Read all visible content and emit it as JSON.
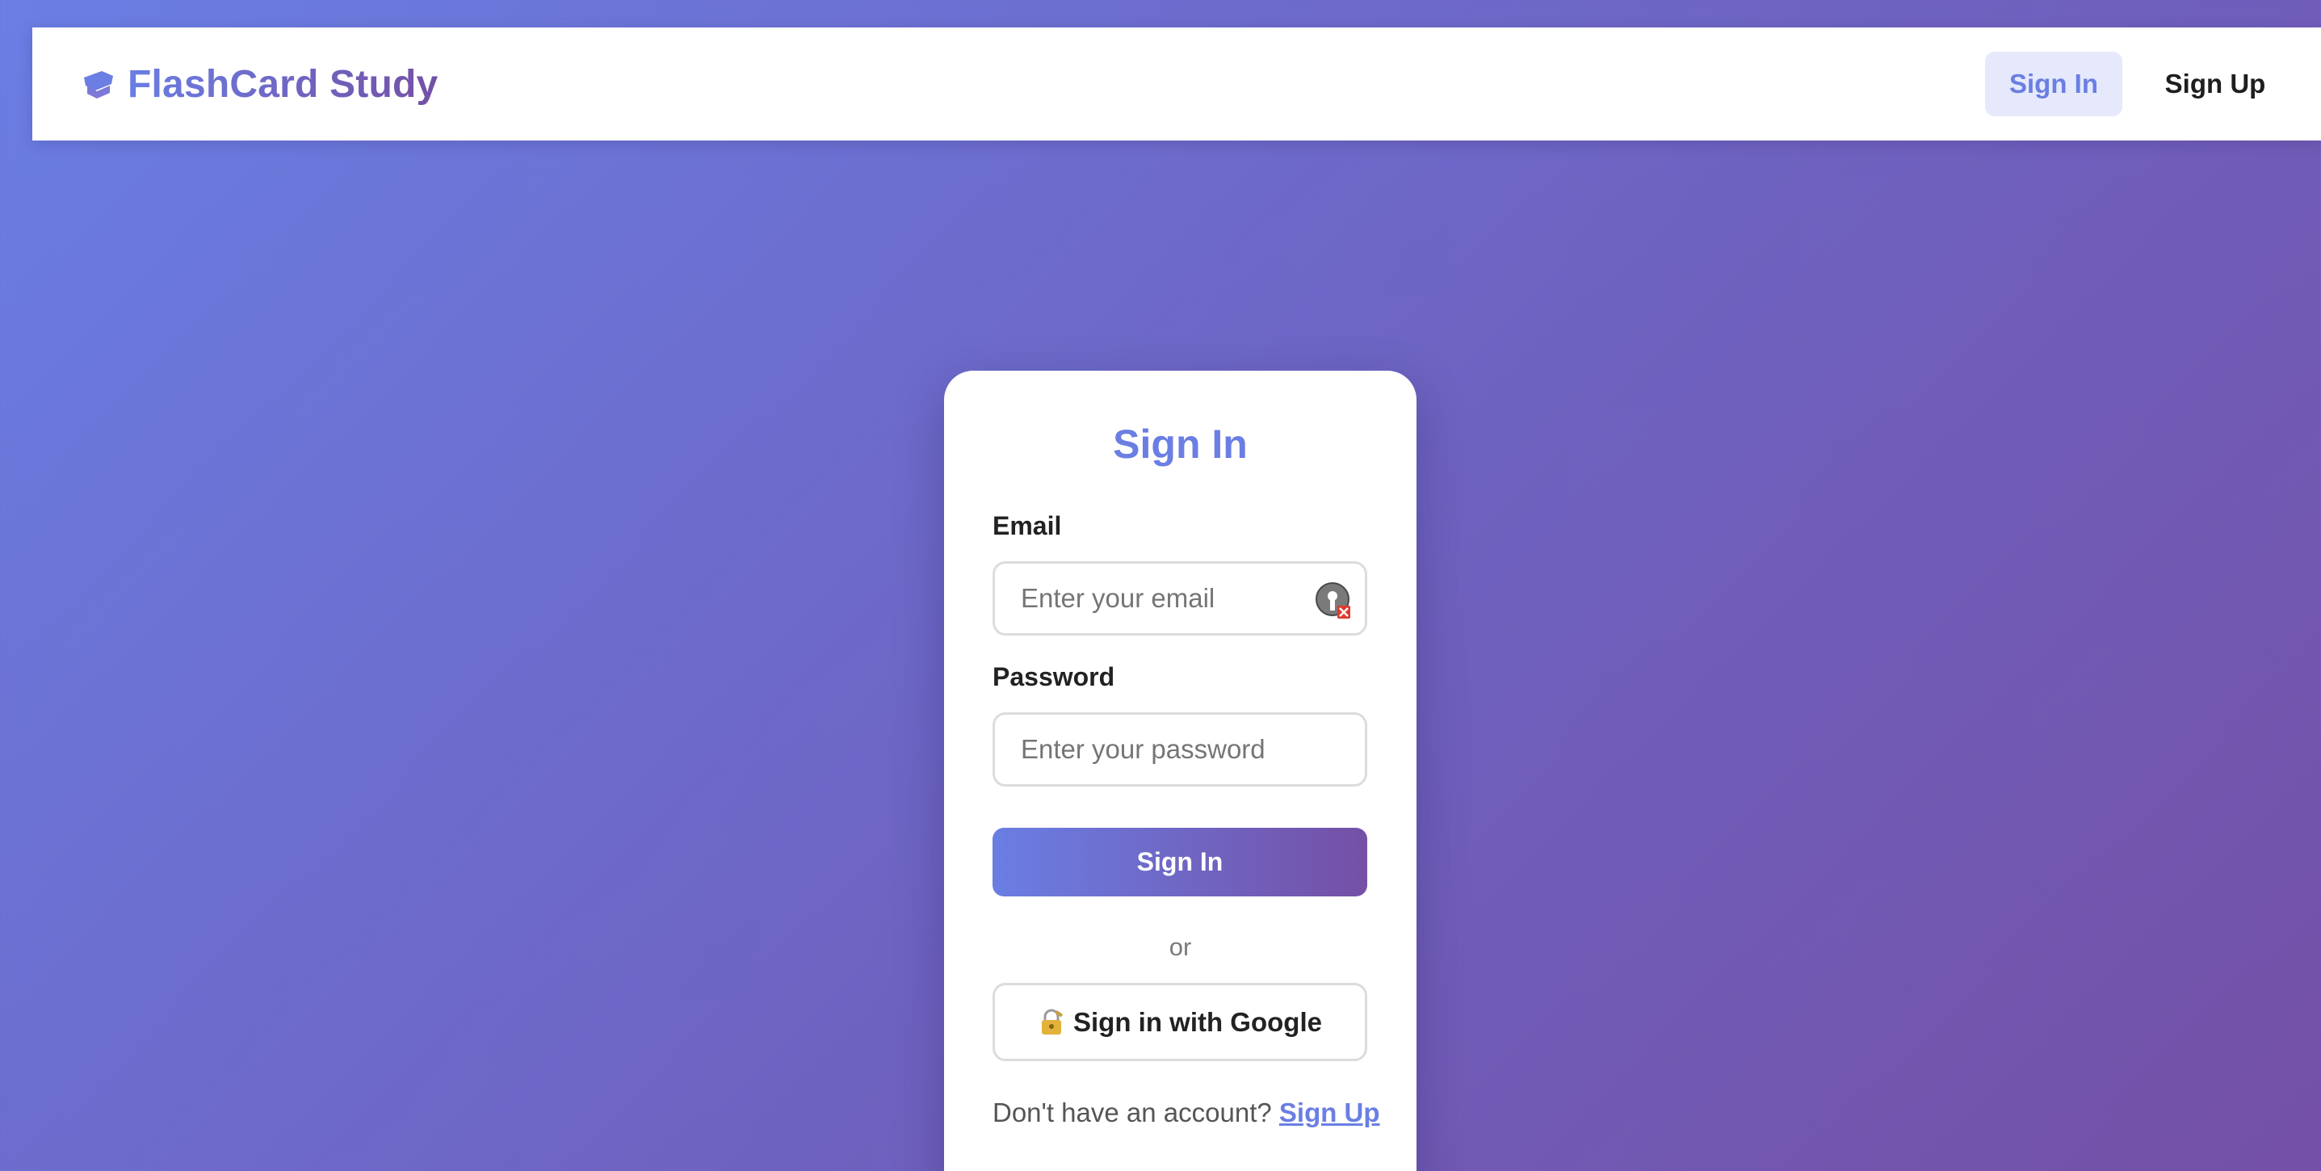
{
  "header": {
    "brand_title": "FlashCard Study",
    "brand_icon": "graduation-cap-icon",
    "nav": {
      "signin_label": "Sign In",
      "signup_label": "Sign Up"
    }
  },
  "signin_card": {
    "title": "Sign In",
    "email": {
      "label": "Email",
      "placeholder": "Enter your email",
      "value": "",
      "icon": "password-manager-icon"
    },
    "password": {
      "label": "Password",
      "placeholder": "Enter your password",
      "value": ""
    },
    "submit_label": "Sign In",
    "divider": "or",
    "google": {
      "icon": "lock-key-icon",
      "label": "Sign in with Google"
    },
    "footer": {
      "prompt": "Don't have an account?",
      "link": "Sign Up"
    }
  },
  "colors": {
    "accent": "#6a7ee3",
    "accent_end": "#7450a6",
    "nav_active_bg": "#e6e9fb"
  }
}
